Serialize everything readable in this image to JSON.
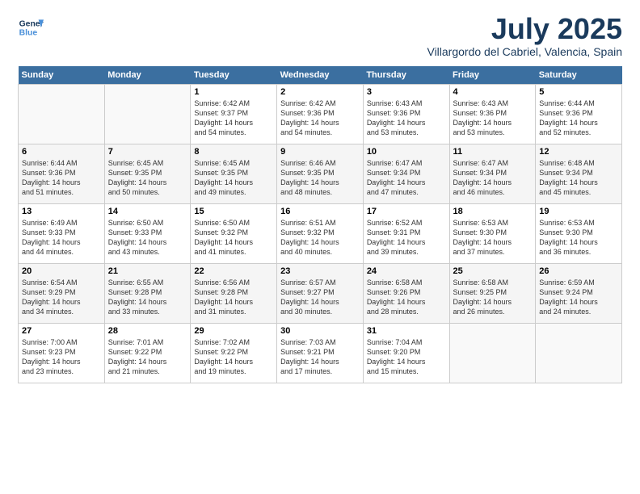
{
  "logo": {
    "line1": "General",
    "line2": "Blue"
  },
  "title": "July 2025",
  "subtitle": "Villargordo del Cabriel, Valencia, Spain",
  "days_of_week": [
    "Sunday",
    "Monday",
    "Tuesday",
    "Wednesday",
    "Thursday",
    "Friday",
    "Saturday"
  ],
  "weeks": [
    [
      {
        "num": "",
        "info": ""
      },
      {
        "num": "",
        "info": ""
      },
      {
        "num": "1",
        "info": "Sunrise: 6:42 AM\nSunset: 9:37 PM\nDaylight: 14 hours\nand 54 minutes."
      },
      {
        "num": "2",
        "info": "Sunrise: 6:42 AM\nSunset: 9:36 PM\nDaylight: 14 hours\nand 54 minutes."
      },
      {
        "num": "3",
        "info": "Sunrise: 6:43 AM\nSunset: 9:36 PM\nDaylight: 14 hours\nand 53 minutes."
      },
      {
        "num": "4",
        "info": "Sunrise: 6:43 AM\nSunset: 9:36 PM\nDaylight: 14 hours\nand 53 minutes."
      },
      {
        "num": "5",
        "info": "Sunrise: 6:44 AM\nSunset: 9:36 PM\nDaylight: 14 hours\nand 52 minutes."
      }
    ],
    [
      {
        "num": "6",
        "info": "Sunrise: 6:44 AM\nSunset: 9:36 PM\nDaylight: 14 hours\nand 51 minutes."
      },
      {
        "num": "7",
        "info": "Sunrise: 6:45 AM\nSunset: 9:35 PM\nDaylight: 14 hours\nand 50 minutes."
      },
      {
        "num": "8",
        "info": "Sunrise: 6:45 AM\nSunset: 9:35 PM\nDaylight: 14 hours\nand 49 minutes."
      },
      {
        "num": "9",
        "info": "Sunrise: 6:46 AM\nSunset: 9:35 PM\nDaylight: 14 hours\nand 48 minutes."
      },
      {
        "num": "10",
        "info": "Sunrise: 6:47 AM\nSunset: 9:34 PM\nDaylight: 14 hours\nand 47 minutes."
      },
      {
        "num": "11",
        "info": "Sunrise: 6:47 AM\nSunset: 9:34 PM\nDaylight: 14 hours\nand 46 minutes."
      },
      {
        "num": "12",
        "info": "Sunrise: 6:48 AM\nSunset: 9:34 PM\nDaylight: 14 hours\nand 45 minutes."
      }
    ],
    [
      {
        "num": "13",
        "info": "Sunrise: 6:49 AM\nSunset: 9:33 PM\nDaylight: 14 hours\nand 44 minutes."
      },
      {
        "num": "14",
        "info": "Sunrise: 6:50 AM\nSunset: 9:33 PM\nDaylight: 14 hours\nand 43 minutes."
      },
      {
        "num": "15",
        "info": "Sunrise: 6:50 AM\nSunset: 9:32 PM\nDaylight: 14 hours\nand 41 minutes."
      },
      {
        "num": "16",
        "info": "Sunrise: 6:51 AM\nSunset: 9:32 PM\nDaylight: 14 hours\nand 40 minutes."
      },
      {
        "num": "17",
        "info": "Sunrise: 6:52 AM\nSunset: 9:31 PM\nDaylight: 14 hours\nand 39 minutes."
      },
      {
        "num": "18",
        "info": "Sunrise: 6:53 AM\nSunset: 9:30 PM\nDaylight: 14 hours\nand 37 minutes."
      },
      {
        "num": "19",
        "info": "Sunrise: 6:53 AM\nSunset: 9:30 PM\nDaylight: 14 hours\nand 36 minutes."
      }
    ],
    [
      {
        "num": "20",
        "info": "Sunrise: 6:54 AM\nSunset: 9:29 PM\nDaylight: 14 hours\nand 34 minutes."
      },
      {
        "num": "21",
        "info": "Sunrise: 6:55 AM\nSunset: 9:28 PM\nDaylight: 14 hours\nand 33 minutes."
      },
      {
        "num": "22",
        "info": "Sunrise: 6:56 AM\nSunset: 9:28 PM\nDaylight: 14 hours\nand 31 minutes."
      },
      {
        "num": "23",
        "info": "Sunrise: 6:57 AM\nSunset: 9:27 PM\nDaylight: 14 hours\nand 30 minutes."
      },
      {
        "num": "24",
        "info": "Sunrise: 6:58 AM\nSunset: 9:26 PM\nDaylight: 14 hours\nand 28 minutes."
      },
      {
        "num": "25",
        "info": "Sunrise: 6:58 AM\nSunset: 9:25 PM\nDaylight: 14 hours\nand 26 minutes."
      },
      {
        "num": "26",
        "info": "Sunrise: 6:59 AM\nSunset: 9:24 PM\nDaylight: 14 hours\nand 24 minutes."
      }
    ],
    [
      {
        "num": "27",
        "info": "Sunrise: 7:00 AM\nSunset: 9:23 PM\nDaylight: 14 hours\nand 23 minutes."
      },
      {
        "num": "28",
        "info": "Sunrise: 7:01 AM\nSunset: 9:22 PM\nDaylight: 14 hours\nand 21 minutes."
      },
      {
        "num": "29",
        "info": "Sunrise: 7:02 AM\nSunset: 9:22 PM\nDaylight: 14 hours\nand 19 minutes."
      },
      {
        "num": "30",
        "info": "Sunrise: 7:03 AM\nSunset: 9:21 PM\nDaylight: 14 hours\nand 17 minutes."
      },
      {
        "num": "31",
        "info": "Sunrise: 7:04 AM\nSunset: 9:20 PM\nDaylight: 14 hours\nand 15 minutes."
      },
      {
        "num": "",
        "info": ""
      },
      {
        "num": "",
        "info": ""
      }
    ]
  ]
}
